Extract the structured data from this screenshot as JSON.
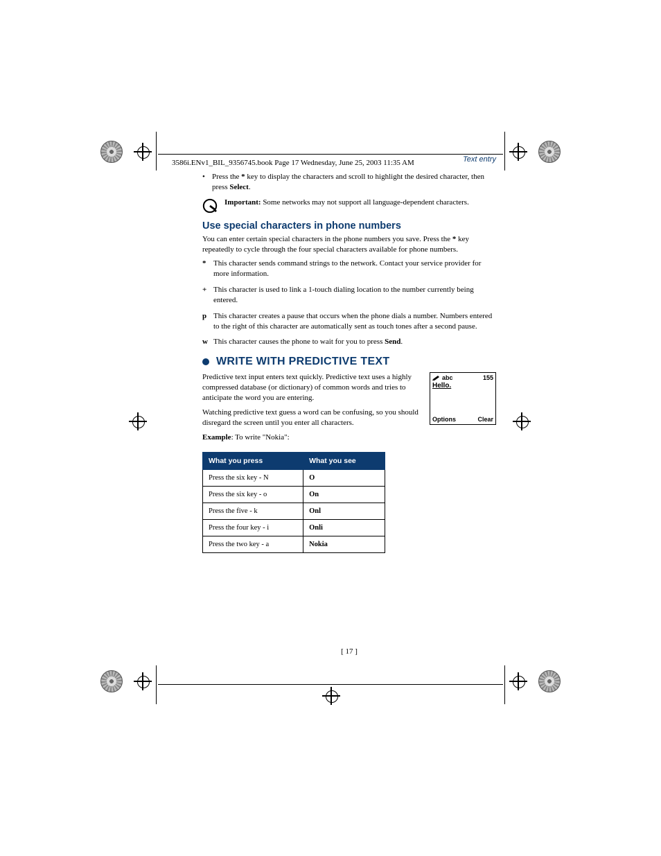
{
  "book_stamp": "3586i.ENv1_BIL_9356745.book  Page 17  Wednesday, June 25, 2003  11:35 AM",
  "header": {
    "section": "Text entry"
  },
  "star_bullet": {
    "pre": "Press the ",
    "star": "*",
    "mid": " key to display the characters and scroll to highlight the desired character, then press ",
    "select": "Select",
    "post": "."
  },
  "important": {
    "label": "Important:",
    "text": " Some networks may not support all language-dependent characters."
  },
  "special": {
    "heading": "Use special characters in phone numbers",
    "intro_pre": "You can enter certain special characters in the phone numbers you save. Press the ",
    "intro_star": "*",
    "intro_post": " key repeatedly to cycle through the four special characters available for phone numbers.",
    "items": [
      {
        "key": "*",
        "text": "This character sends command strings to the network. Contact your service provider for more information."
      },
      {
        "key": "+",
        "text": "This character is used to link a 1-touch dialing location to the number currently being entered."
      },
      {
        "key": "p",
        "text": "This character creates a pause that occurs when the phone dials a number. Numbers entered to the right of this character are automatically sent as touch tones after a second pause."
      },
      {
        "key": "w",
        "text_pre": "This character causes the phone to wait for you to press ",
        "text_bold": "Send",
        "text_post": "."
      }
    ]
  },
  "predictive": {
    "heading": "WRITE WITH PREDICTIVE TEXT",
    "p1": "Predictive text input enters text quickly. Predictive text uses a highly compressed database (or dictionary) of common words and tries to anticipate the word you are entering.",
    "p2": "Watching predictive text guess a word can be confusing, so you should disregard the screen until you enter all characters.",
    "example_label": "Example",
    "example_text": ": To write \"Nokia\":",
    "screen": {
      "mode": "abc",
      "count": "155",
      "word": "Hello.",
      "left": "Options",
      "right": "Clear"
    }
  },
  "chart_data": {
    "type": "table",
    "columns": [
      "What you press",
      "What you see"
    ],
    "rows": [
      [
        "Press the six key - N",
        "O"
      ],
      [
        "Press the six key - o",
        "On"
      ],
      [
        "Press the five - k",
        "Onl"
      ],
      [
        "Press the four key - i",
        "Onli"
      ],
      [
        "Press the two key - a",
        "Nokia"
      ]
    ]
  },
  "page_number": "[ 17 ]"
}
